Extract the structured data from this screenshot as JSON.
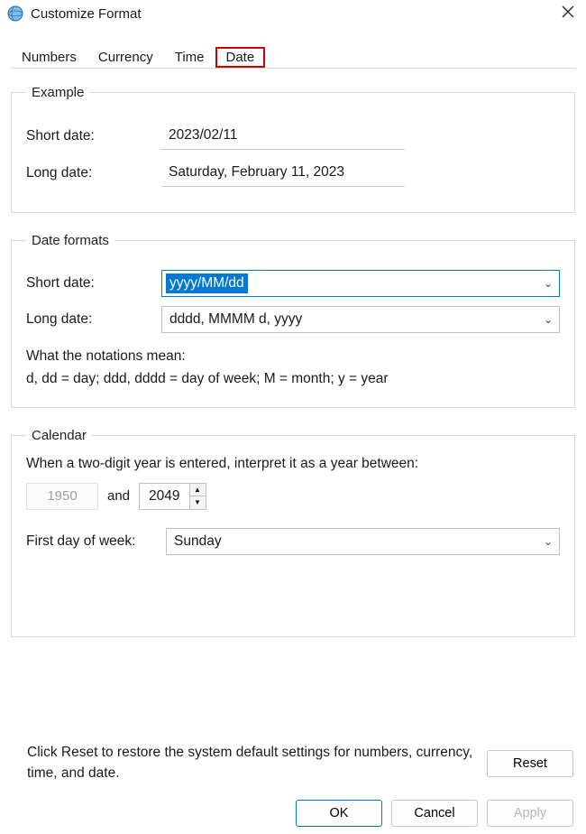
{
  "window": {
    "title": "Customize Format"
  },
  "tabs": {
    "numbers": "Numbers",
    "currency": "Currency",
    "time": "Time",
    "date": "Date"
  },
  "example": {
    "legend": "Example",
    "short_label": "Short date:",
    "short_value": "2023/02/11",
    "long_label": "Long date:",
    "long_value": "Saturday, February 11, 2023"
  },
  "formats": {
    "legend": "Date formats",
    "short_label": "Short date:",
    "short_value": "yyyy/MM/dd",
    "long_label": "Long date:",
    "long_value": "dddd, MMMM d, yyyy",
    "notation_heading": "What the notations mean:",
    "notation_body": "d, dd = day;  ddd, dddd = day of week;  M = month;  y = year"
  },
  "calendar": {
    "legend": "Calendar",
    "two_digit_text": "When a two-digit year is entered, interpret it as a year between:",
    "year_from": "1950",
    "and": "and",
    "year_to": "2049",
    "first_day_label": "First day of week:",
    "first_day_value": "Sunday"
  },
  "footer": {
    "reset_desc": "Click Reset to restore the system default settings for numbers, currency, time, and date.",
    "reset": "Reset",
    "ok": "OK",
    "cancel": "Cancel",
    "apply": "Apply"
  }
}
